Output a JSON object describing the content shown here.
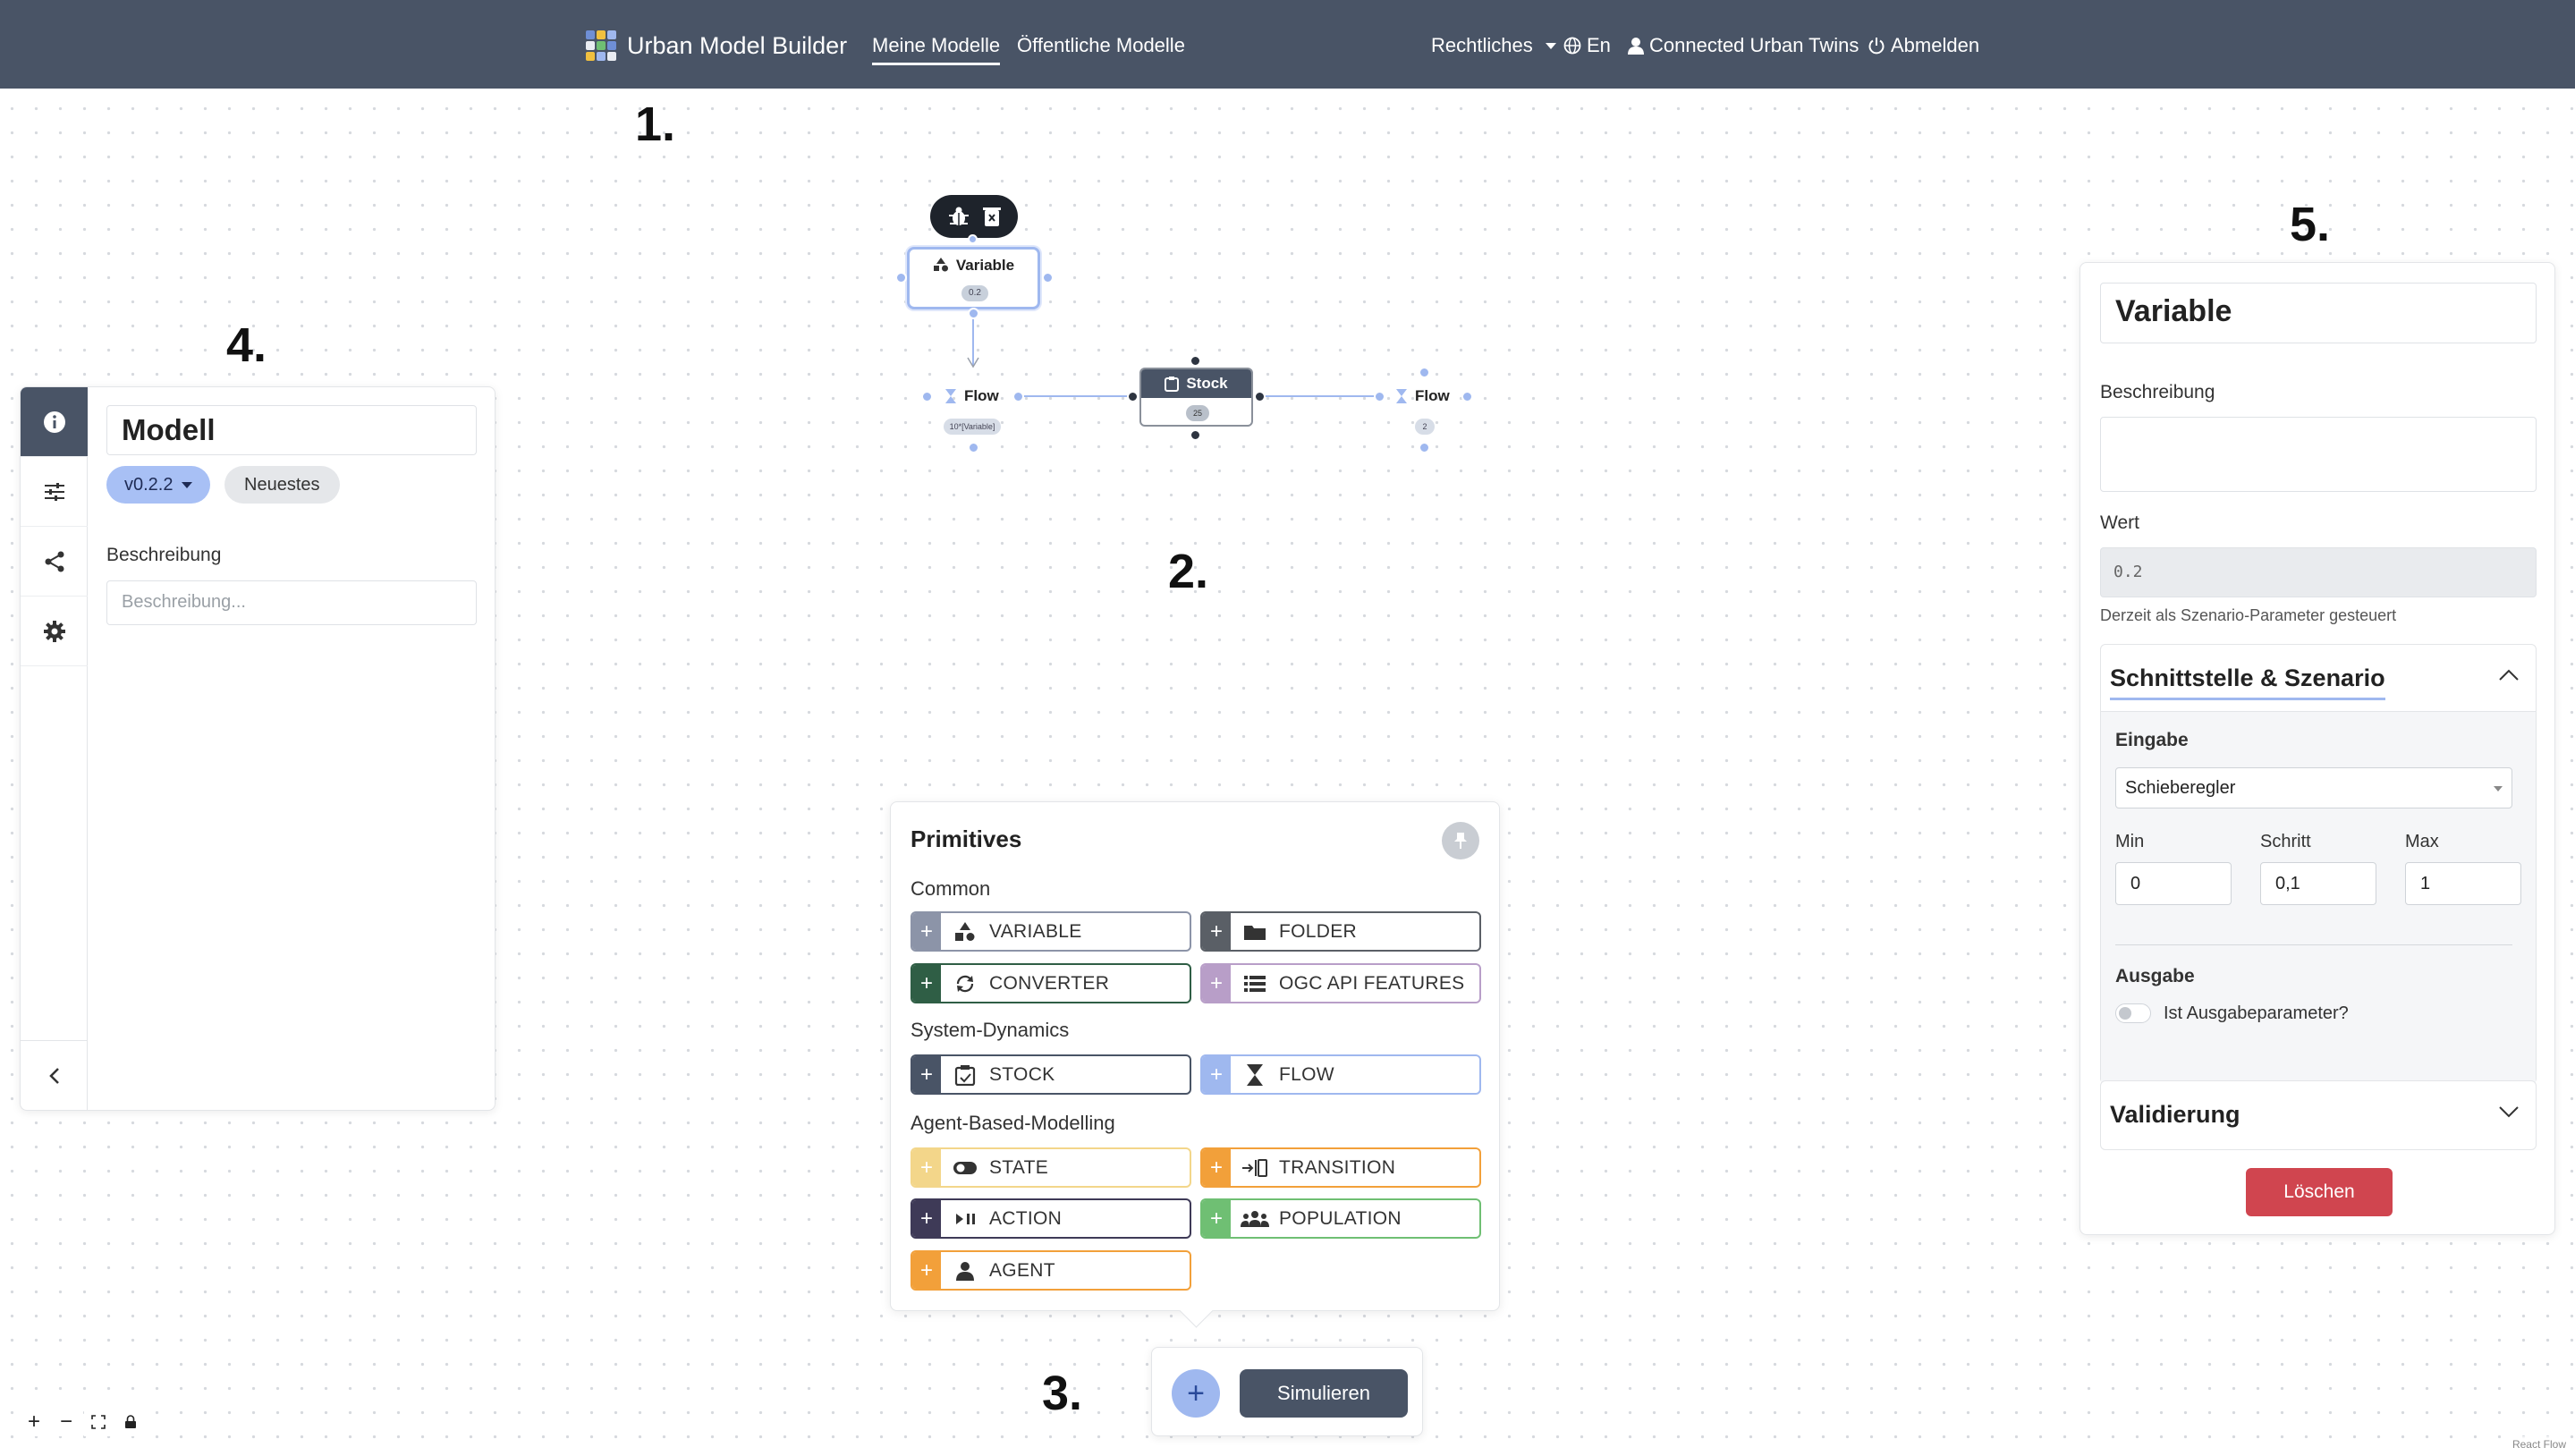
{
  "navbar": {
    "brand": "Urban Model Builder",
    "links": [
      "Meine Modelle",
      "Öffentliche Modelle"
    ],
    "legal": "Rechtliches",
    "language": "En",
    "user": "Connected Urban Twins",
    "logout": "Abmelden",
    "colors": {
      "background": "#495466"
    }
  },
  "annotations": [
    "1.",
    "2.",
    "3.",
    "4.",
    "5."
  ],
  "left_panel": {
    "title": "Modell",
    "version": "v0.2.2",
    "latest": "Neuestes",
    "description_label": "Beschreibung",
    "description_placeholder": "Beschreibung...",
    "rail_icons": [
      "info-icon",
      "sliders-icon",
      "share-icon",
      "gear-icon"
    ],
    "collapse_icon": "chevron-left-icon"
  },
  "canvas": {
    "variable_node": {
      "label": "Variable",
      "value": "0.2"
    },
    "flow_left": {
      "label": "Flow",
      "value": "10*[Variable]"
    },
    "stock_node": {
      "label": "Stock",
      "value": "25"
    },
    "flow_right": {
      "label": "Flow",
      "value": "2"
    }
  },
  "primitives": {
    "title": "Primitives",
    "sections": {
      "common": "Common",
      "system_dynamics": "System-Dynamics",
      "abm": "Agent-Based-Modelling"
    },
    "buttons": {
      "variable": "VARIABLE",
      "folder": "FOLDER",
      "converter": "CONVERTER",
      "ogc": "OGC API FEATURES",
      "stock": "STOCK",
      "flow": "FLOW",
      "state": "STATE",
      "transition": "TRANSITION",
      "action": "ACTION",
      "population": "POPULATION",
      "agent": "AGENT"
    },
    "colors": {
      "variable": "#8c94a8",
      "folder": "#5a5f66",
      "converter": "#2f5e45",
      "ogc": "#b89ec8",
      "stock": "#495466",
      "flow": "#9fb8ef",
      "state": "#f3d68a",
      "transition": "#f2a03a",
      "action": "#3e3a57",
      "population": "#6fbf73",
      "agent": "#f2a03a"
    }
  },
  "bottom_bar": {
    "add": "+",
    "simulate": "Simulieren"
  },
  "right_panel": {
    "title": "Variable",
    "description_label": "Beschreibung",
    "value_label": "Wert",
    "value": "0.2",
    "hint": "Derzeit als Szenario-Parameter gesteuert",
    "interface_section": "Schnittstelle & Szenario",
    "input_label": "Eingabe",
    "input_type": "Schieberegler",
    "min_label": "Min",
    "step_label": "Schritt",
    "max_label": "Max",
    "min": "0",
    "step": "0,1",
    "max": "1",
    "output_label": "Ausgabe",
    "output_toggle_label": "Ist Ausgabeparameter?",
    "validation_section": "Validierung",
    "delete": "Löschen"
  },
  "react_flow": {
    "attribution": "React Flow"
  }
}
